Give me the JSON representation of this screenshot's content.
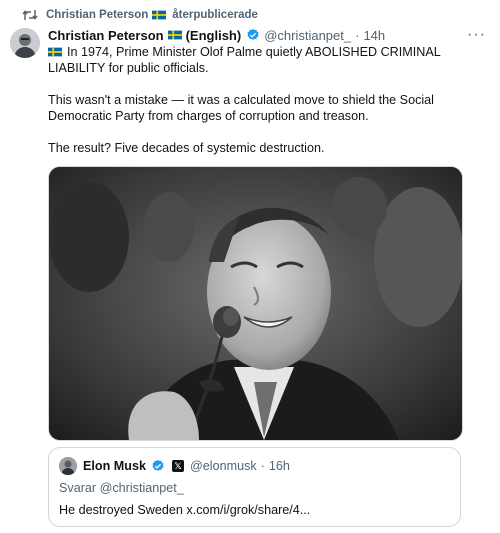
{
  "repost": {
    "icon": "repost-icon",
    "reposter": "Christian Peterson",
    "flag": "swedish-flag-icon",
    "action": "återpublicerade"
  },
  "tweet": {
    "author_name": "Christian Peterson",
    "author_suffix": "(English)",
    "handle": "@christianpet_",
    "separator": "·",
    "time": "14h",
    "more_icon": "more-icon",
    "more_label": "···",
    "paragraphs": [
      "In 1974, Prime Minister Olof Palme quietly ABOLISHED CRIMINAL LIABILITY for public officials.",
      "This wasn't a mistake — it was a calculated move to shield the Social Democratic Party from charges of corruption and treason.",
      "The result? Five decades of systemic destruction."
    ]
  },
  "quote": {
    "author_name": "Elon Musk",
    "handle": "@elonmusk",
    "separator": "·",
    "time": "16h",
    "x_badge": "𝕏",
    "reply_to": "Svarar @christianpet_",
    "text": "He destroyed Sweden x.com/i/grok/share/4..."
  },
  "colors": {
    "text": "#0f1419",
    "secondary": "#536471",
    "verified": "#1d9bf0",
    "border": "#cfd9de",
    "flag_blue": "#006aa7",
    "flag_yellow": "#fecc00"
  }
}
